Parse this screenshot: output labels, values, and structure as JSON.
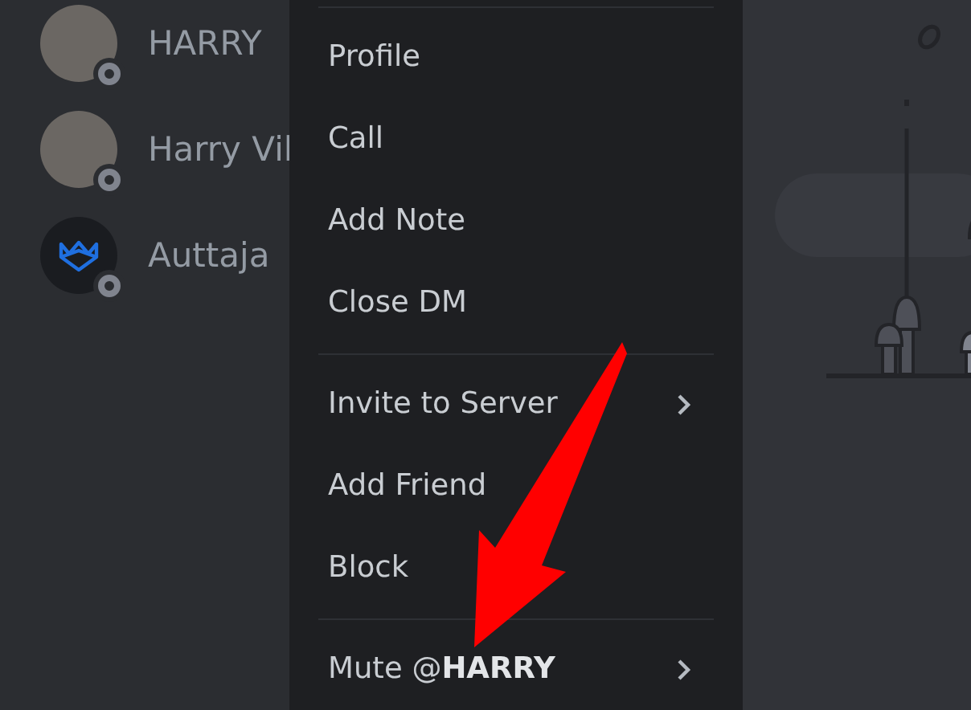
{
  "friends": [
    {
      "name": "HARRY",
      "online": false,
      "kind": "photo"
    },
    {
      "name": "Harry Vil",
      "online": false,
      "kind": "photo"
    },
    {
      "name": "Auttaja",
      "online": false,
      "kind": "logo"
    }
  ],
  "context_menu": {
    "groups": [
      {
        "items": [
          {
            "label": "Profile",
            "submenu": false
          },
          {
            "label": "Call",
            "submenu": false
          },
          {
            "label": "Add Note",
            "submenu": false
          },
          {
            "label": "Close DM",
            "submenu": false
          }
        ]
      },
      {
        "items": [
          {
            "label": "Invite to Server",
            "submenu": true
          },
          {
            "label": "Add Friend",
            "submenu": false
          },
          {
            "label": "Block",
            "submenu": false
          }
        ]
      },
      {
        "items": [
          {
            "label": "Mute @**HARRY**",
            "submenu": true
          }
        ]
      }
    ]
  }
}
